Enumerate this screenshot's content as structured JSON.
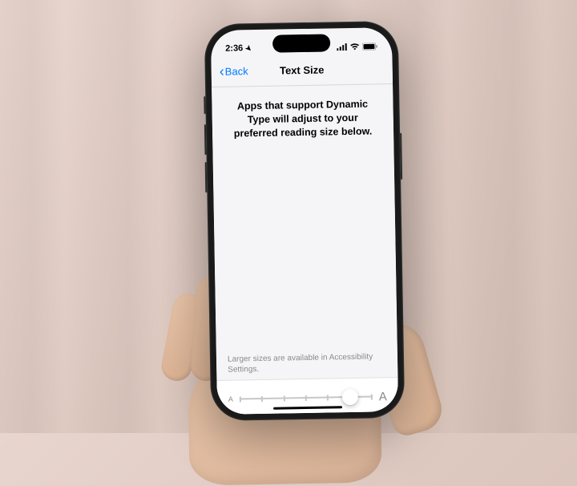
{
  "status_bar": {
    "time": "2:36",
    "location_indicator": "◀",
    "signal_label": "signal",
    "wifi_label": "wifi",
    "battery_label": "battery"
  },
  "nav": {
    "back_label": "Back",
    "title": "Text Size"
  },
  "content": {
    "description": "Apps that support Dynamic Type will adjust to your preferred reading size below."
  },
  "footer": {
    "note": "Larger sizes are available in Accessibility Settings."
  },
  "slider": {
    "small_label": "A",
    "large_label": "A",
    "ticks": 7,
    "position_index": 5,
    "knob_left_percent": "83%"
  }
}
